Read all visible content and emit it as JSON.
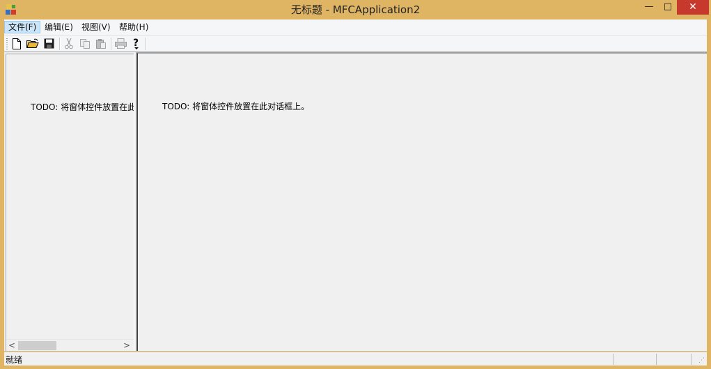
{
  "window": {
    "title": "无标题 - MFCApplication2",
    "minimize_glyph": "—",
    "maximize_glyph": "□",
    "close_glyph": "✕"
  },
  "menu": {
    "items": [
      {
        "label": "文件(F)"
      },
      {
        "label": "编辑(E)"
      },
      {
        "label": "视图(V)"
      },
      {
        "label": "帮助(H)"
      }
    ],
    "active_index": 0
  },
  "toolbar": {
    "buttons": [
      "new-file-icon",
      "open-folder-icon",
      "save-icon",
      "cut-icon",
      "copy-icon",
      "paste-icon",
      "print-icon",
      "help-icon"
    ],
    "disabled": [
      "cut-icon",
      "copy-icon",
      "paste-icon",
      "print-icon"
    ]
  },
  "left_pane": {
    "text": "TODO: 将窗体控件放置在此"
  },
  "right_pane": {
    "text": "TODO: 将窗体控件放置在此对话框上。"
  },
  "scrollbar": {
    "left_arrow": "<",
    "right_arrow": ">",
    "position": 0.0
  },
  "status": {
    "text": "就绪"
  },
  "colors": {
    "title_bar": "#dfb463",
    "close_button": "#c7392d",
    "menu_active": "#cce4f7"
  }
}
